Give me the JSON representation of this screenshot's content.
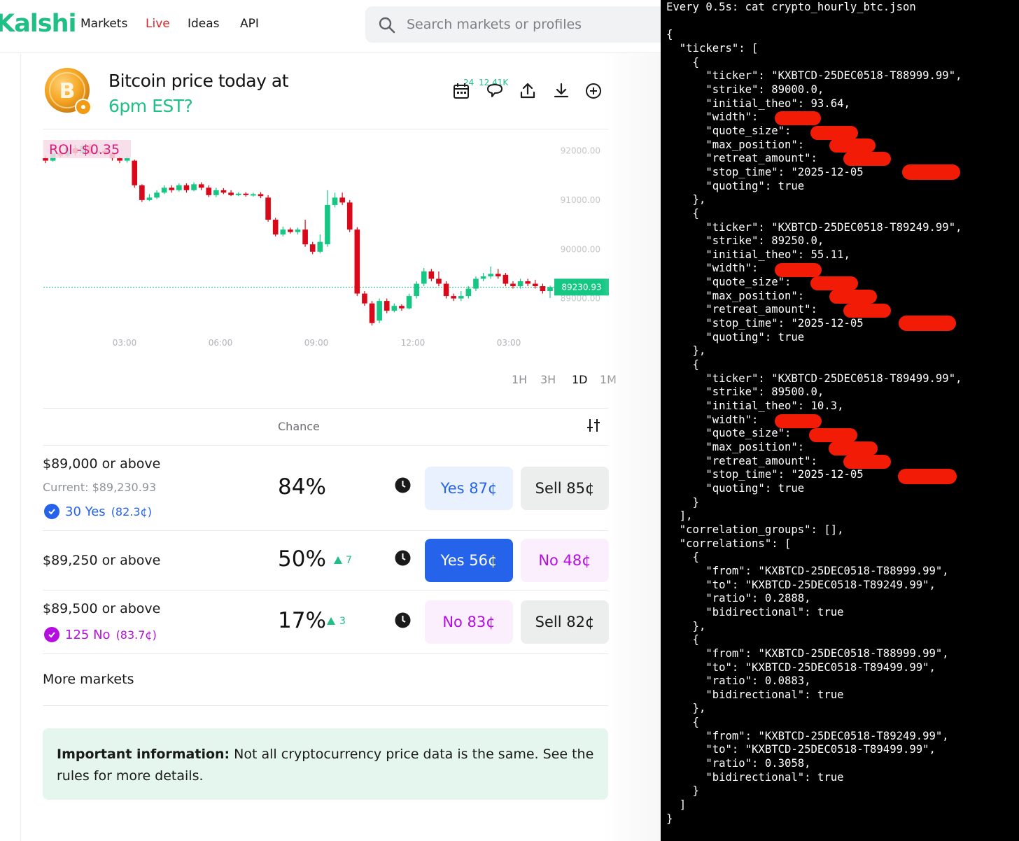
{
  "nav": {
    "logo": "Kalshi",
    "links": [
      "Markets",
      "Live",
      "Ideas",
      "API"
    ],
    "search_placeholder": "Search markets or profiles"
  },
  "market": {
    "title_line1": "Bitcoin price today at",
    "title_line2": "6pm EST?",
    "calendar_count": "24",
    "comment_count": "12.41K"
  },
  "chart_data": {
    "type": "candlestick",
    "roi_label": "ROI -$0.35",
    "current_price_label": "89230.93",
    "current_price": 89230.93,
    "y_ticks": [
      "92000.00",
      "91000.00",
      "90000.00",
      "89000.00"
    ],
    "x_ticks": [
      "03:00",
      "06:00",
      "09:00",
      "12:00",
      "03:00"
    ],
    "ylim": [
      88440,
      92420
    ],
    "candles": [
      {
        "o": 91850,
        "c": 91800,
        "h": 91900,
        "l": 91750
      },
      {
        "o": 91800,
        "c": 91950,
        "h": 92020,
        "l": 91780
      },
      {
        "o": 91950,
        "c": 91900,
        "h": 92050,
        "l": 91860
      },
      {
        "o": 91900,
        "c": 92050,
        "h": 92100,
        "l": 91880
      },
      {
        "o": 92050,
        "c": 91950,
        "h": 92120,
        "l": 91900
      },
      {
        "o": 91950,
        "c": 92100,
        "h": 92150,
        "l": 91920
      },
      {
        "o": 92100,
        "c": 91950,
        "h": 92140,
        "l": 91900
      },
      {
        "o": 91950,
        "c": 92000,
        "h": 92060,
        "l": 91900
      },
      {
        "o": 92000,
        "c": 91950,
        "h": 92040,
        "l": 91900
      },
      {
        "o": 91950,
        "c": 91850,
        "h": 91990,
        "l": 91800
      },
      {
        "o": 91850,
        "c": 91800,
        "h": 91880,
        "l": 91750
      },
      {
        "o": 91800,
        "c": 91850,
        "h": 91900,
        "l": 91760
      },
      {
        "o": 91800,
        "c": 91300,
        "h": 91820,
        "l": 91250
      },
      {
        "o": 91300,
        "c": 91000,
        "h": 91320,
        "l": 90960
      },
      {
        "o": 91000,
        "c": 91050,
        "h": 91120,
        "l": 90980
      },
      {
        "o": 91050,
        "c": 91150,
        "h": 91200,
        "l": 91020
      },
      {
        "o": 91150,
        "c": 91250,
        "h": 91300,
        "l": 91120
      },
      {
        "o": 91250,
        "c": 91200,
        "h": 91300,
        "l": 91150
      },
      {
        "o": 91200,
        "c": 91300,
        "h": 91340,
        "l": 91170
      },
      {
        "o": 91300,
        "c": 91200,
        "h": 91340,
        "l": 91150
      },
      {
        "o": 91200,
        "c": 91320,
        "h": 91360,
        "l": 91180
      },
      {
        "o": 91320,
        "c": 91250,
        "h": 91360,
        "l": 91200
      },
      {
        "o": 91250,
        "c": 91100,
        "h": 91300,
        "l": 91060
      },
      {
        "o": 91100,
        "c": 91200,
        "h": 91250,
        "l": 91060
      },
      {
        "o": 91200,
        "c": 91150,
        "h": 91240,
        "l": 91120
      },
      {
        "o": 91150,
        "c": 91100,
        "h": 91200,
        "l": 91080
      },
      {
        "o": 91100,
        "c": 91130,
        "h": 91160,
        "l": 91080
      },
      {
        "o": 91130,
        "c": 91100,
        "h": 91160,
        "l": 91070
      },
      {
        "o": 91100,
        "c": 91120,
        "h": 91150,
        "l": 91070
      },
      {
        "o": 91120,
        "c": 91080,
        "h": 91160,
        "l": 91040
      },
      {
        "o": 91050,
        "c": 90600,
        "h": 91100,
        "l": 90560
      },
      {
        "o": 90600,
        "c": 90300,
        "h": 90640,
        "l": 90260
      },
      {
        "o": 90300,
        "c": 90400,
        "h": 90460,
        "l": 90260
      },
      {
        "o": 90400,
        "c": 90350,
        "h": 90440,
        "l": 90320
      },
      {
        "o": 90350,
        "c": 90400,
        "h": 90440,
        "l": 90300
      },
      {
        "o": 90400,
        "c": 90100,
        "h": 90600,
        "l": 90050
      },
      {
        "o": 90100,
        "c": 89950,
        "h": 90150,
        "l": 89900
      },
      {
        "o": 89950,
        "c": 90150,
        "h": 90300,
        "l": 89920
      },
      {
        "o": 90100,
        "c": 90900,
        "h": 91200,
        "l": 90050
      },
      {
        "o": 90900,
        "c": 91050,
        "h": 91150,
        "l": 90850
      },
      {
        "o": 91050,
        "c": 90950,
        "h": 91150,
        "l": 90900
      },
      {
        "o": 90950,
        "c": 90400,
        "h": 91000,
        "l": 90350
      },
      {
        "o": 90400,
        "c": 89100,
        "h": 90450,
        "l": 89050
      },
      {
        "o": 89100,
        "c": 88900,
        "h": 89150,
        "l": 88850
      },
      {
        "o": 88900,
        "c": 88500,
        "h": 88950,
        "l": 88450
      },
      {
        "o": 88550,
        "c": 88950,
        "h": 89000,
        "l": 88500
      },
      {
        "o": 88950,
        "c": 88750,
        "h": 89000,
        "l": 88700
      },
      {
        "o": 88750,
        "c": 88850,
        "h": 88900,
        "l": 88720
      },
      {
        "o": 88850,
        "c": 88800,
        "h": 88880,
        "l": 88750
      },
      {
        "o": 88800,
        "c": 89050,
        "h": 89100,
        "l": 88780
      },
      {
        "o": 89050,
        "c": 89300,
        "h": 89350,
        "l": 89000
      },
      {
        "o": 89300,
        "c": 89550,
        "h": 89620,
        "l": 89250
      },
      {
        "o": 89550,
        "c": 89400,
        "h": 89600,
        "l": 89350
      },
      {
        "o": 89400,
        "c": 89300,
        "h": 89550,
        "l": 89250
      },
      {
        "o": 89300,
        "c": 89050,
        "h": 89350,
        "l": 89000
      },
      {
        "o": 89050,
        "c": 89000,
        "h": 89100,
        "l": 88950
      },
      {
        "o": 89000,
        "c": 89050,
        "h": 89150,
        "l": 88950
      },
      {
        "o": 89050,
        "c": 89200,
        "h": 89250,
        "l": 89000
      },
      {
        "o": 89200,
        "c": 89400,
        "h": 89450,
        "l": 89150
      },
      {
        "o": 89400,
        "c": 89450,
        "h": 89520,
        "l": 89350
      },
      {
        "o": 89450,
        "c": 89500,
        "h": 89650,
        "l": 89400
      },
      {
        "o": 89500,
        "c": 89450,
        "h": 89600,
        "l": 89400
      },
      {
        "o": 89480,
        "c": 89300,
        "h": 89520,
        "l": 89250
      },
      {
        "o": 89300,
        "c": 89250,
        "h": 89350,
        "l": 89200
      },
      {
        "o": 89250,
        "c": 89350,
        "h": 89400,
        "l": 89200
      },
      {
        "o": 89350,
        "c": 89300,
        "h": 89400,
        "l": 89250
      },
      {
        "o": 89300,
        "c": 89250,
        "h": 89380,
        "l": 89200
      },
      {
        "o": 89250,
        "c": 89150,
        "h": 89300,
        "l": 89100
      },
      {
        "o": 89150,
        "c": 89230,
        "h": 89260,
        "l": 89010
      }
    ]
  },
  "timeframes": [
    "1H",
    "3H",
    "1D",
    "1M"
  ],
  "timeframe_active": "1D",
  "table": {
    "header": "Chance",
    "rows": [
      {
        "label": "$89,000 or above",
        "sub": "Current: $89,230.93",
        "position": "30 Yes",
        "avg": "(82.3¢)",
        "chance": "84%",
        "delta": "",
        "btn1": "Yes 87¢",
        "btn2": "Sell 85¢"
      },
      {
        "label": "$89,250 or above",
        "sub": "",
        "position": "",
        "avg": "",
        "chance": "50%",
        "delta": "7",
        "btn1": "Yes 56¢",
        "btn2": "No 48¢"
      },
      {
        "label": "$89,500 or above",
        "sub": "",
        "position": "125 No",
        "avg": "(83.7¢)",
        "chance": "17%",
        "delta": "3",
        "btn1": "No 83¢",
        "btn2": "Sell 82¢"
      }
    ]
  },
  "more_markets": "More markets",
  "info": {
    "bold": "Important information:",
    "text": " Not all cryptocurrency price data is the same. See the rules for more details."
  },
  "terminal": {
    "lines": [
      "Every 0.5s: cat crypto_hourly_btc.json",
      "",
      "{",
      "  \"tickers\": [",
      "    {",
      "      \"ticker\": \"KXBTCD-25DEC0518-T88999.99\",",
      "      \"strike\": 89000.0,",
      "      \"initial_theo\": 93.64,",
      "      \"width\":",
      "      \"quote_size\":",
      "      \"max_position\":",
      "      \"retreat_amount\":",
      "      \"stop_time\": \"2025-12-05",
      "      \"quoting\": true",
      "    },",
      "    {",
      "      \"ticker\": \"KXBTCD-25DEC0518-T89249.99\",",
      "      \"strike\": 89250.0,",
      "      \"initial_theo\": 55.11,",
      "      \"width\":",
      "      \"quote_size\":",
      "      \"max_position\":",
      "      \"retreat_amount\":",
      "      \"stop_time\": \"2025-12-05",
      "      \"quoting\": true",
      "    },",
      "    {",
      "      \"ticker\": \"KXBTCD-25DEC0518-T89499.99\",",
      "      \"strike\": 89500.0,",
      "      \"initial_theo\": 10.3,",
      "      \"width\":",
      "      \"quote_size\":",
      "      \"max_position\":",
      "      \"retreat_amount\":",
      "      \"stop_time\": \"2025-12-05",
      "      \"quoting\": true",
      "    }",
      "  ],",
      "  \"correlation_groups\": [],",
      "  \"correlations\": [",
      "    {",
      "      \"from\": \"KXBTCD-25DEC0518-T88999.99\",",
      "      \"to\": \"KXBTCD-25DEC0518-T89249.99\",",
      "      \"ratio\": 0.2888,",
      "      \"bidirectional\": true",
      "    },",
      "    {",
      "      \"from\": \"KXBTCD-25DEC0518-T88999.99\",",
      "      \"to\": \"KXBTCD-25DEC0518-T89499.99\",",
      "      \"ratio\": 0.0883,",
      "      \"bidirectional\": true",
      "    },",
      "    {",
      "      \"from\": \"KXBTCD-25DEC0518-T89249.99\",",
      "      \"to\": \"KXBTCD-25DEC0518-T89499.99\",",
      "      \"ratio\": 0.3058,",
      "      \"bidirectional\": true",
      "    }",
      "  ]",
      "}"
    ]
  },
  "colors": {
    "brand": "#1fbf86",
    "up": "#16c784",
    "down": "#d9091a",
    "yes": "#2563eb",
    "no": "#b40fe0",
    "redaction": "#f21b05"
  }
}
